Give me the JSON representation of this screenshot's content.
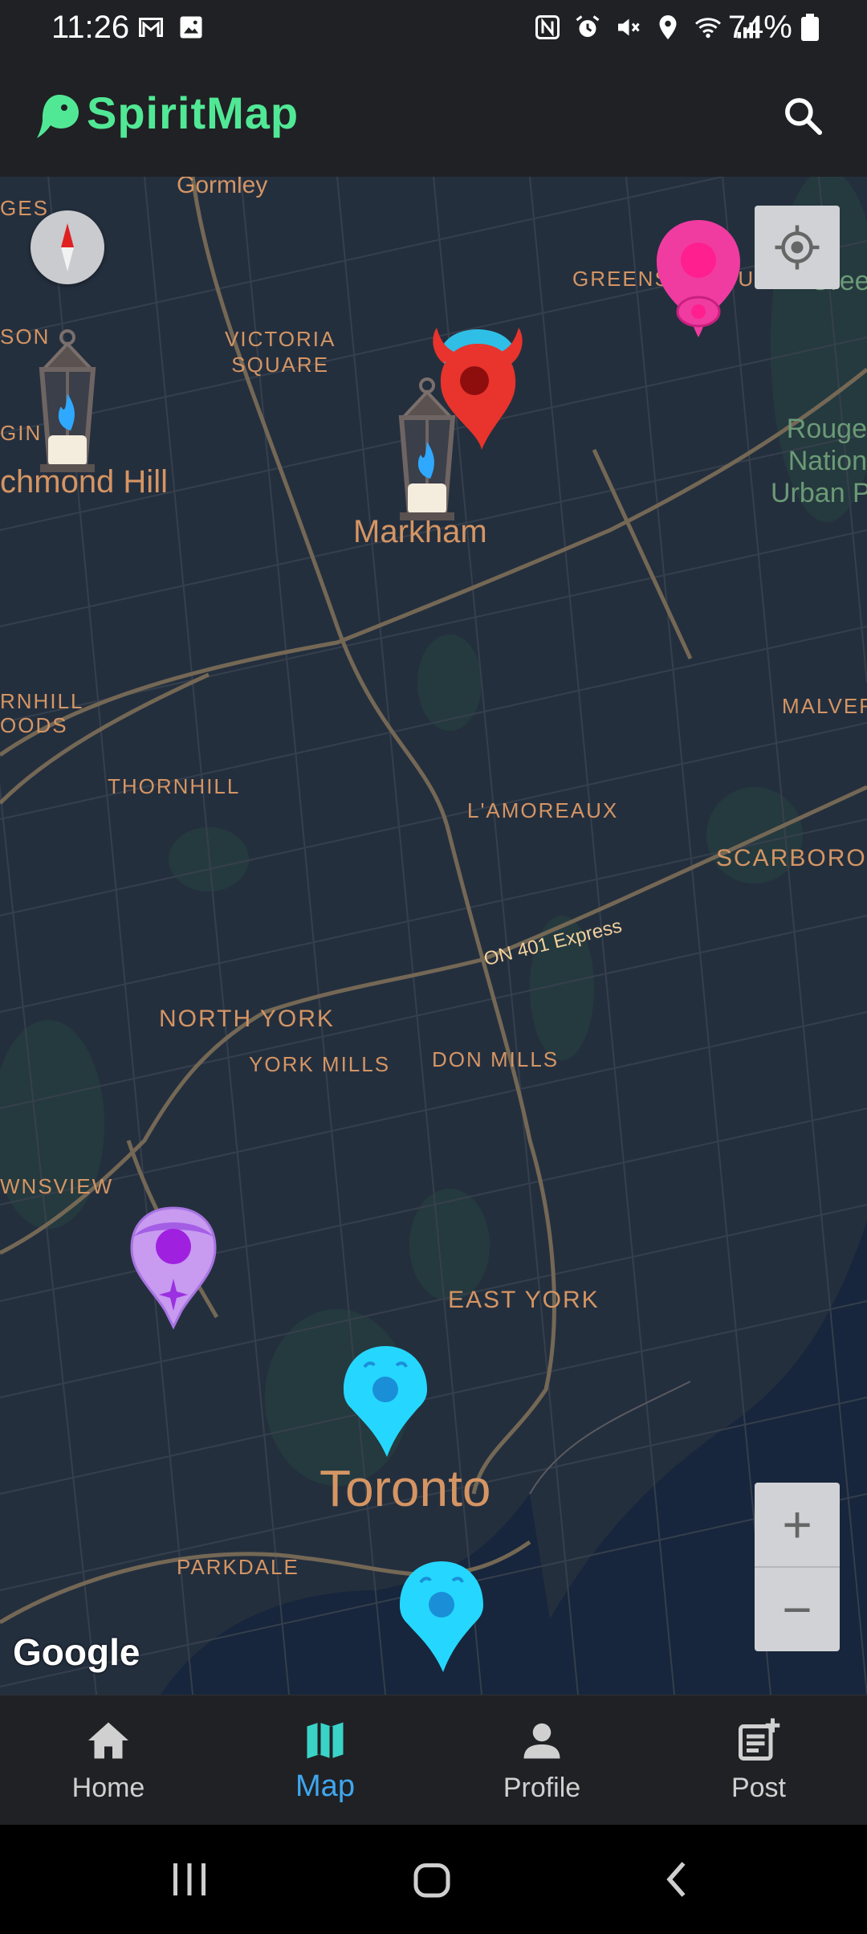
{
  "status_bar": {
    "time": "11:26",
    "battery": "74%",
    "left_icons": [
      "gmail-icon",
      "gallery-icon"
    ],
    "right_icons": [
      "nfc-icon",
      "alarm-icon",
      "mute-icon",
      "location-icon",
      "wifi-icon",
      "signal-icon",
      "battery-icon"
    ]
  },
  "app_bar": {
    "title": "SpiritMap",
    "logo_icon": "ghost-icon",
    "search_icon": "search-icon",
    "accent": "#51e895"
  },
  "map": {
    "labels": {
      "gormley": "Gormley",
      "ges": "GES",
      "son": "SON",
      "gin": "GIN",
      "victoria_square": "VICTORIA\nSQUARE",
      "greensborough": "GREENSBOROUGH",
      "green": "Green",
      "rouge": "Rouge\nNation\nUrban P",
      "richmond_hill": "chmond Hill",
      "markham": "Markham",
      "thornhill_woods": "RNHILL\nOODS",
      "malvern": "MALVER",
      "thornhill": "THORNHILL",
      "lamoureaux": "L'AMOREAUX",
      "scarborough": "SCARBORO",
      "highway": "ON 401 Express",
      "north_york": "NORTH YORK",
      "york_mills": "YORK MILLS",
      "don_mills": "DON MILLS",
      "westview": "WNSVIEW",
      "east_york": "EAST YORK",
      "toronto": "Toronto",
      "parkdale": "PARKDALE"
    },
    "google_logo": "Google",
    "zoom_in": "+",
    "zoom_out": "−",
    "markers": [
      {
        "type": "lantern",
        "name": "lantern-marker"
      },
      {
        "type": "lantern",
        "name": "lantern-marker"
      },
      {
        "type": "devil",
        "name": "devil-marker"
      },
      {
        "type": "pink-pin",
        "name": "pink-marker"
      },
      {
        "type": "purple-pin",
        "name": "purple-marker"
      },
      {
        "type": "ghost",
        "name": "ghost-marker"
      },
      {
        "type": "ghost",
        "name": "ghost-marker"
      }
    ]
  },
  "bottom_nav": {
    "items": [
      {
        "label": "Home",
        "icon": "home-icon",
        "active": false
      },
      {
        "label": "Map",
        "icon": "map-icon",
        "active": true
      },
      {
        "label": "Profile",
        "icon": "person-icon",
        "active": false
      },
      {
        "label": "Post",
        "icon": "post-add-icon",
        "active": false
      }
    ],
    "active_color": "#3fa7ef"
  },
  "system_nav": {
    "buttons": [
      "recents-button",
      "home-button",
      "back-button"
    ]
  }
}
